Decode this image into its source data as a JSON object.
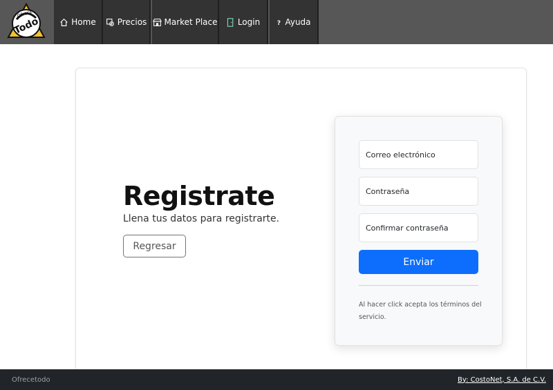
{
  "brand": {
    "logo_text": "Ofrece Todo"
  },
  "nav": {
    "items": [
      {
        "label": "Home",
        "icon": "home-icon"
      },
      {
        "label": "Precios",
        "icon": "price-tag-icon"
      },
      {
        "label": "Market Place",
        "icon": "store-icon"
      },
      {
        "label": "Login",
        "icon": "door-icon"
      },
      {
        "label": "Ayuda",
        "icon": "question-icon"
      }
    ]
  },
  "hero": {
    "title": "Registrate",
    "subtitle": "Llena tus datos para registrarte.",
    "back_button": "Regresar"
  },
  "form": {
    "email_placeholder": "Correo electrónico",
    "password_placeholder": "Contraseña",
    "confirm_placeholder": "Confirmar contraseña",
    "submit_label": "Enviar",
    "terms": "Al hacer click acepta los términos del servicio."
  },
  "footer": {
    "brand": "Ofrecetodo",
    "credit": "By: CostoNet, S.A. de C.V."
  },
  "colors": {
    "nav_bg": "#575757",
    "nav_item_bg": "#333333",
    "primary": "#0d6efd",
    "footer_bg": "#212529"
  }
}
